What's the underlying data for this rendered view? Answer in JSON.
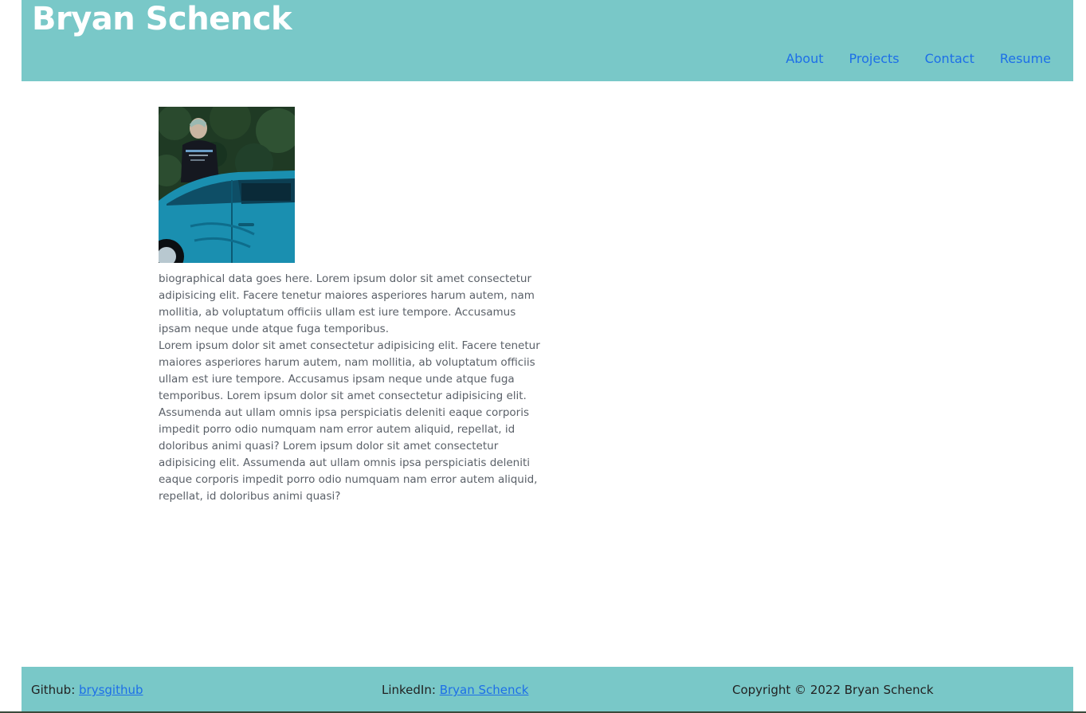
{
  "header": {
    "title": "Bryan Schenck",
    "nav": [
      {
        "label": "About"
      },
      {
        "label": "Projects"
      },
      {
        "label": "Contact"
      },
      {
        "label": "Resume"
      }
    ]
  },
  "main": {
    "photo_alt": "Photo of Bryan Schenck standing next to a blue car",
    "bio_paragraph_1": "biographical data goes here. Lorem ipsum dolor sit amet consectetur adipisicing elit. Facere tenetur maiores asperiores harum autem, nam mollitia, ab voluptatum officiis ullam est iure tempore. Accusamus ipsam neque unde atque fuga temporibus.",
    "bio_paragraph_2": "Lorem ipsum dolor sit amet consectetur adipisicing elit. Facere tenetur maiores asperiores harum autem, nam mollitia, ab voluptatum officiis ullam est iure tempore. Accusamus ipsam neque unde atque fuga temporibus. Lorem ipsum dolor sit amet consectetur adipisicing elit. Assumenda aut ullam omnis ipsa perspiciatis deleniti eaque corporis impedit porro odio numquam nam error autem aliquid, repellat, id doloribus animi quasi? Lorem ipsum dolor sit amet consectetur adipisicing elit. Assumenda aut ullam omnis ipsa perspiciatis deleniti eaque corporis impedit porro odio numquam nam error autem aliquid, repellat, id doloribus animi quasi?"
  },
  "footer": {
    "github_label": "Github:",
    "github_link": "brysgithub",
    "linkedin_label": "LinkedIn:",
    "linkedin_link": "Bryan Schenck",
    "copyright": "Copyright © 2022 Bryan Schenck"
  },
  "colors": {
    "header_bg": "#79c8c8",
    "link": "#1d6fe8",
    "title": "#ffffff"
  }
}
